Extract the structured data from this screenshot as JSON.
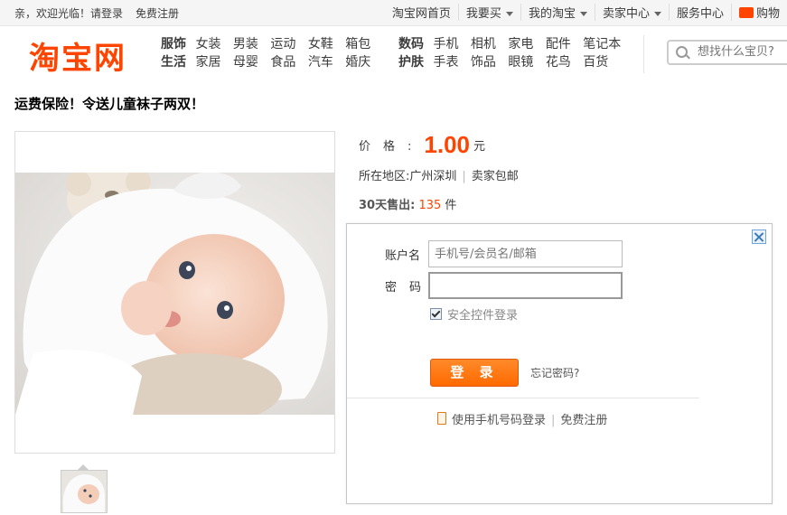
{
  "topbar": {
    "greeting": "亲，欢迎光临！",
    "login_link": "请登录",
    "register_link": "免费注册",
    "nav": [
      {
        "label": "淘宝网首页",
        "dropdown": false
      },
      {
        "label": "我要买",
        "dropdown": true
      },
      {
        "label": "我的淘宝",
        "dropdown": true
      },
      {
        "label": "卖家中心",
        "dropdown": true
      },
      {
        "label": "服务中心",
        "dropdown": false
      }
    ],
    "cart_label": "购物"
  },
  "header": {
    "logo": "淘宝网",
    "cat_group_1": {
      "row1_head": "服饰",
      "row1_items": [
        "女装",
        "男装",
        "运动",
        "女鞋",
        "箱包"
      ],
      "row2_head": "生活",
      "row2_items": [
        "家居",
        "母婴",
        "食品",
        "汽车",
        "婚庆"
      ]
    },
    "cat_group_2": {
      "row1_head": "数码",
      "row1_items": [
        "手机",
        "相机",
        "家电",
        "配件",
        "笔记本"
      ],
      "row2_head": "护肤",
      "row2_items": [
        "手表",
        "饰品",
        "眼镜",
        "花鸟",
        "百货"
      ]
    },
    "search_placeholder": "想找什么宝贝?"
  },
  "item": {
    "title": "运费保险！令送儿童袜子两双！",
    "price_label": "价格:",
    "price": "1.00",
    "price_unit": "元",
    "location_label": "所在地区:",
    "location": "广州深圳",
    "shipping": "卖家包邮",
    "sold_label": "30天售出:",
    "sold_count": "135",
    "sold_unit": "件"
  },
  "login": {
    "account_label": "账户名",
    "account_placeholder": "手机号/会员名/邮箱",
    "password_label": "密码",
    "secure_control": "安全控件登录",
    "submit": "登 录",
    "forgot": "忘记密码?",
    "phone_login": "使用手机号码登录",
    "register": "免费注册"
  },
  "colors": {
    "brand": "#ff4400",
    "button": "#ff6600"
  }
}
